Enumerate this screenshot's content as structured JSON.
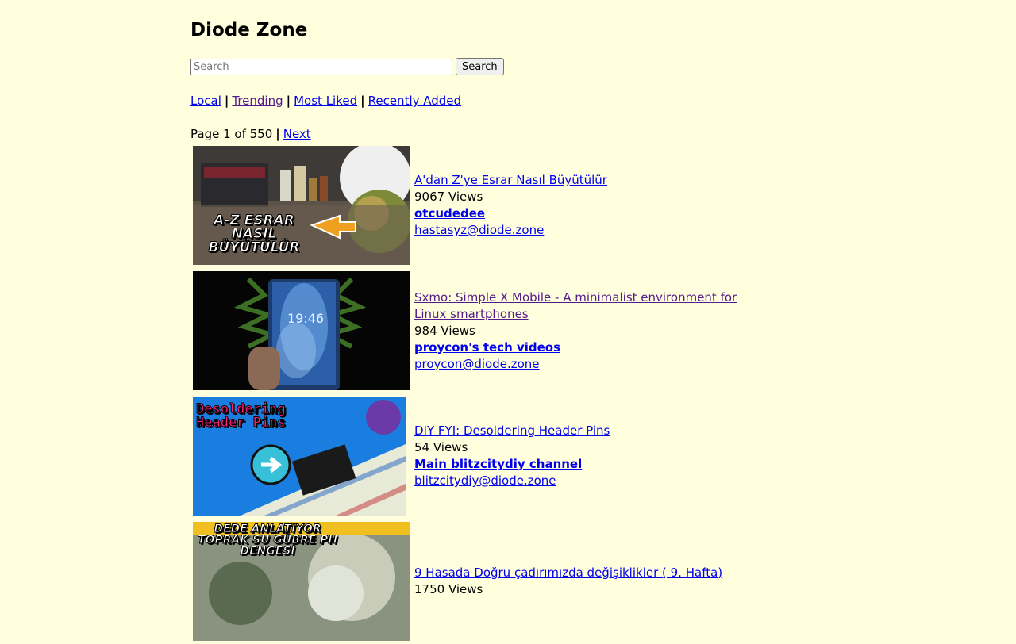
{
  "site": {
    "title": "Diode Zone"
  },
  "search": {
    "placeholder": "Search",
    "value": "",
    "button_label": "Search"
  },
  "nav": {
    "local": "Local",
    "trending": "Trending",
    "most_liked": "Most Liked",
    "recently_added": "Recently Added",
    "separator": "|"
  },
  "pager": {
    "text": "Page 1 of 550",
    "separator": "|",
    "next": "Next"
  },
  "videos": [
    {
      "title": "A'dan Z'ye Esrar Nasıl Büyütülür",
      "views": "9067 Views",
      "channel": "otcudedee",
      "account": "hastasyz@diode.zone",
      "thumb_text": "A-Z ESRAR NASIL BÜYÜTÜLÜR"
    },
    {
      "title": "Sxmo: Simple X Mobile - A minimalist environment for Linux smartphones",
      "views": "984 Views",
      "channel": "proycon's tech videos",
      "account": "proycon@diode.zone",
      "thumb_text": "19:46"
    },
    {
      "title": "DIY FYI: Desoldering Header Pins",
      "views": "54 Views",
      "channel": "Main blitzcitydiy channel",
      "account": "blitzcitydiy@diode.zone",
      "thumb_text": "Desoldering Header Pins"
    },
    {
      "title": "9 Hasada Doğru çadırımızda değişiklikler ( 9. Hafta)",
      "views": "1750 Views",
      "channel": "",
      "account": "",
      "thumb_text": "DEDE ANLATIYOR TOPRAK SU GÜBRE PH DENGESİ"
    }
  ],
  "colors": {
    "background": "#ffffdd",
    "link": "#0000ee",
    "visited_link": "#551a8b"
  }
}
